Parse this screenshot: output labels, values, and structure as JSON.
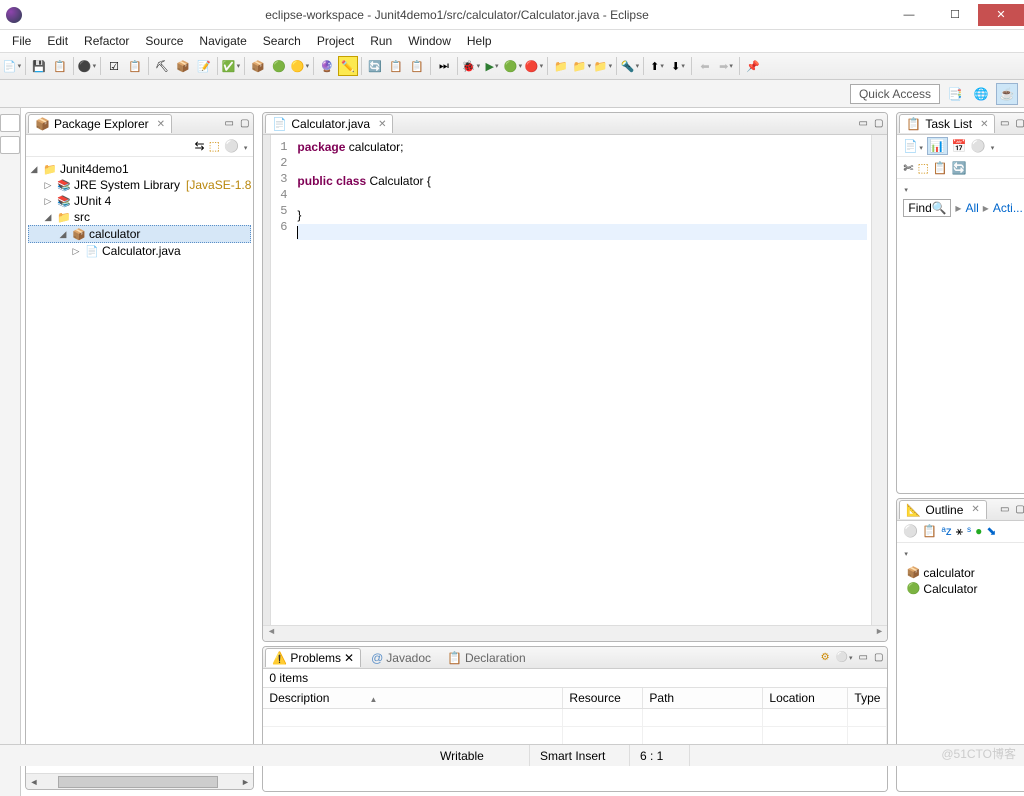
{
  "window": {
    "title": "eclipse-workspace - Junit4demo1/src/calculator/Calculator.java - Eclipse"
  },
  "menu": [
    "File",
    "Edit",
    "Refactor",
    "Source",
    "Navigate",
    "Search",
    "Project",
    "Run",
    "Window",
    "Help"
  ],
  "quick_access": "Quick Access",
  "pkg_explorer": {
    "title": "Package Explorer",
    "tree": {
      "project": "Junit4demo1",
      "jre": "JRE System Library",
      "jre_suffix": "[JavaSE-1.8",
      "junit": "JUnit 4",
      "src": "src",
      "pkg": "calculator",
      "file": "Calculator.java"
    }
  },
  "editor": {
    "tab": "Calculator.java",
    "lines": {
      "l1_kw": "package",
      "l1_rest": " calculator;",
      "l3_kw1": "public",
      "l3_kw2": "class",
      "l3_rest": " Calculator {",
      "l5": "}"
    }
  },
  "task_list": {
    "title": "Task List",
    "find": "Find",
    "all": "All",
    "acti": "Acti..."
  },
  "outline": {
    "title": "Outline",
    "pkg": "calculator",
    "cls": "Calculator"
  },
  "problems": {
    "tab_problems": "Problems",
    "tab_javadoc": "Javadoc",
    "tab_decl": "Declaration",
    "count": "0 items",
    "cols": {
      "desc": "Description",
      "res": "Resource",
      "path": "Path",
      "loc": "Location",
      "type": "Type"
    }
  },
  "status": {
    "writable": "Writable",
    "insert": "Smart Insert",
    "pos": "6 : 1"
  },
  "watermark": "@51CTO博客"
}
